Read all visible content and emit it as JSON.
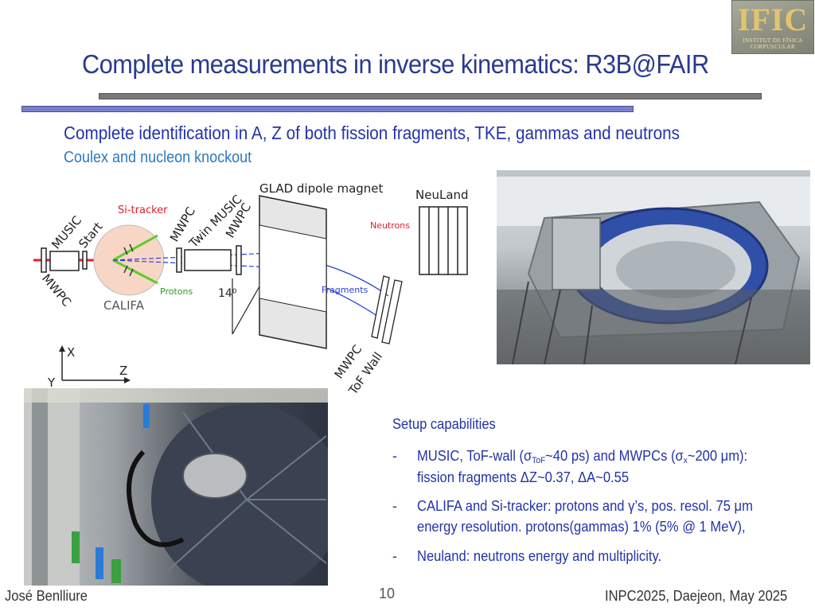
{
  "logo": {
    "text": "IFIC",
    "subtext": "INSTITUT DE FÍSICA CORPUSCULAR"
  },
  "title": "Complete measurements in inverse kinematics: R3B@FAIR",
  "subtitle": "Complete identification in A, Z of both fission fragments, TKE, gammas and neutrons",
  "subtitle2": "Coulex and nucleon knockout",
  "diagram": {
    "labels": {
      "glad": "GLAD dipole magnet",
      "neuland": "NeuLand",
      "neutrons": "Neutrons",
      "si_tracker": "Si-tracker",
      "music": "MUSIC",
      "start": "Start",
      "mwpc_left": "MWPC",
      "mwpc1": "MWPC",
      "twin_music": "Twin MUSIC",
      "mwpc2": "MWPC",
      "protons": "Protons",
      "califa": "CALIFA",
      "angle": "14⁰",
      "fragments": "Fragments",
      "mwpc_tof": "MWPC",
      "tof_wall": "ToF Wall",
      "axis_x": "X",
      "axis_y": "Y",
      "axis_z": "Z"
    }
  },
  "capabilities": {
    "title": "Setup capabilities",
    "dash": "-",
    "items": [
      {
        "line1_a": "MUSIC, ToF-wall (",
        "sigma": "σ",
        "sub1": "ToF",
        "line1_b": "~40 ps) and MWPCs (",
        "sub2": "x",
        "line1_c": "~200 μm):",
        "line2": "fission fragments ΔZ~0.37, ΔA~0.55"
      },
      {
        "line1": "CALIFA and Si-tracker: protons and γ’s, pos. resol. 75 μm",
        "line2": "energy resolution. protons(gammas) 1% (5% @ 1 MeV),"
      },
      {
        "line1": "Neuland: neutrons energy and multiplicity."
      }
    ]
  },
  "footer": {
    "author": "José Benlliure",
    "page": "10",
    "conference": "INPC2025, Daejeon, May 2025"
  },
  "colors": {
    "title": "#2a3a8e",
    "text_blue": "#2233aa",
    "light_blue": "#2c78c0",
    "beam_red": "#e0202a",
    "proton_green": "#5ccc2a",
    "fragment_blue": "#2b3fd6"
  }
}
